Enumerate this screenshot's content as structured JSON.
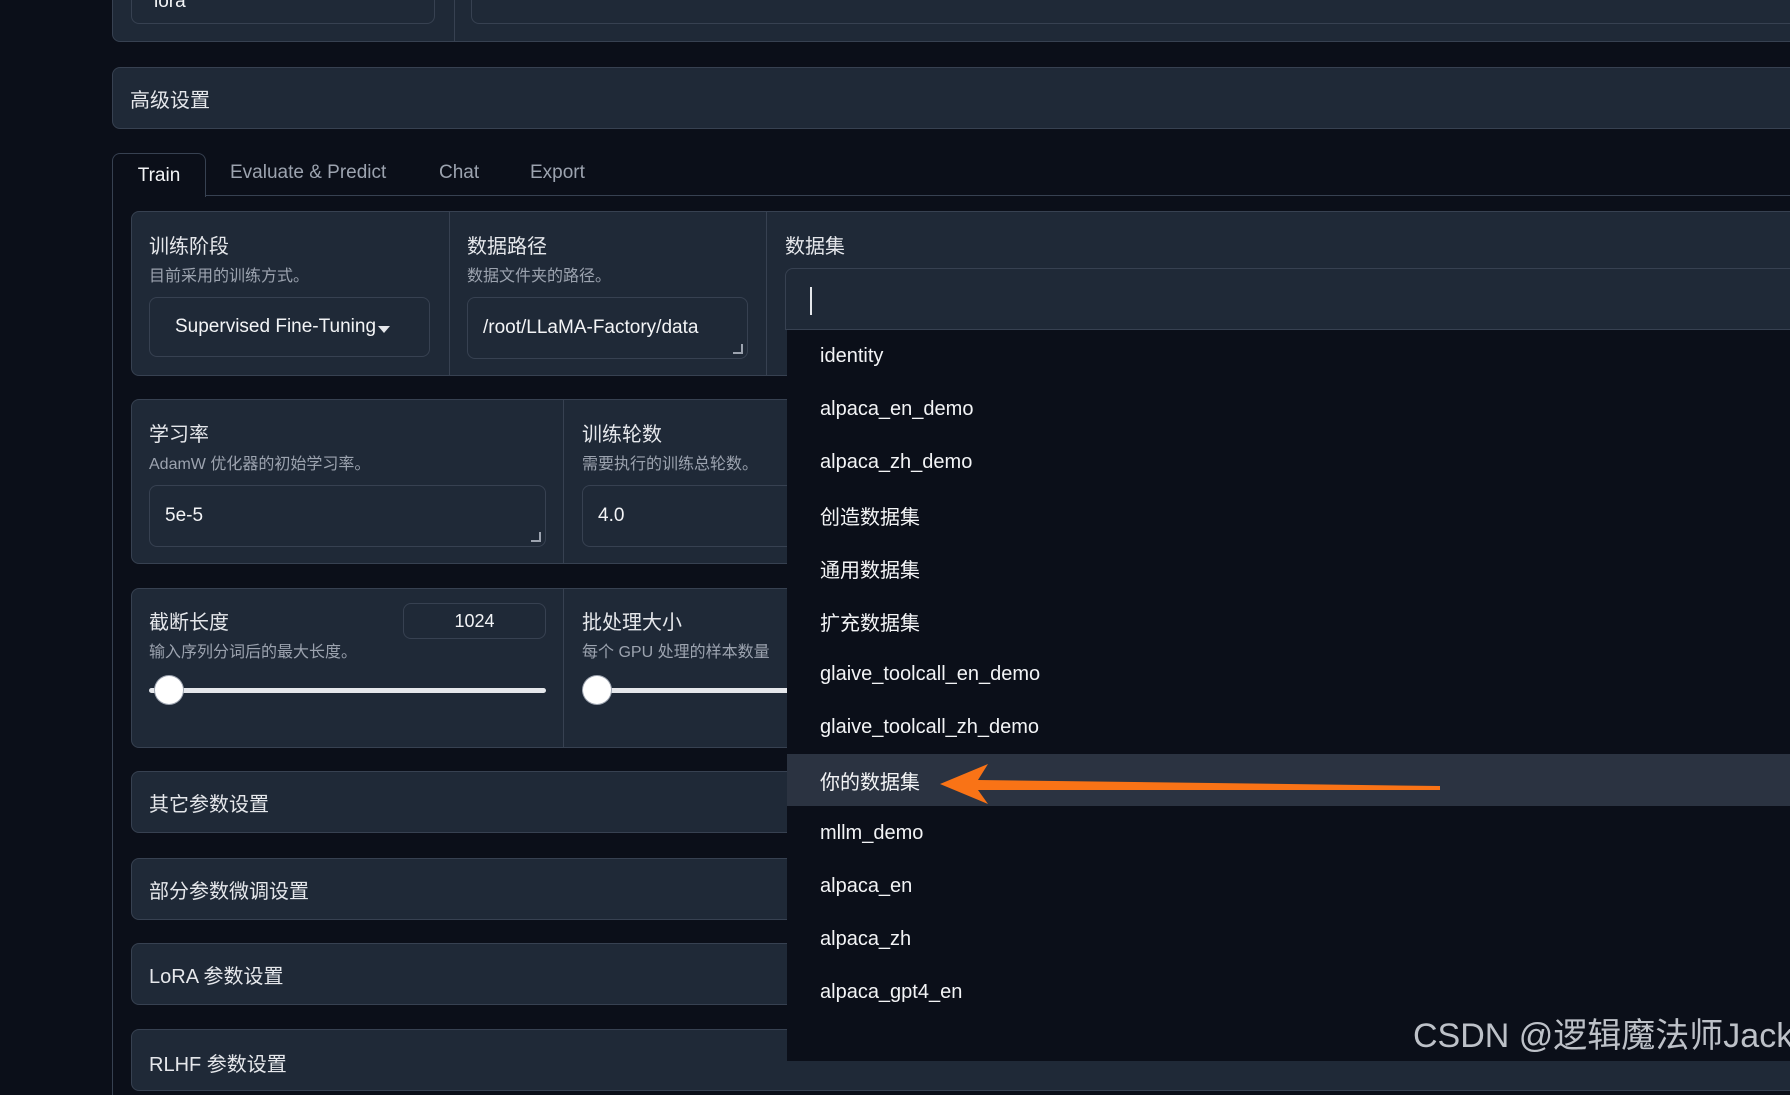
{
  "top_partial": {
    "left_value": "lora"
  },
  "advanced": {
    "label": "高级设置"
  },
  "tabs": [
    {
      "label": "Train",
      "active": true
    },
    {
      "label": "Evaluate & Predict",
      "active": false
    },
    {
      "label": "Chat",
      "active": false
    },
    {
      "label": "Export",
      "active": false
    }
  ],
  "stage": {
    "title": "训练阶段",
    "info": "目前采用的训练方式。",
    "value": "Supervised Fine-Tuning"
  },
  "data_path": {
    "title": "数据路径",
    "info": "数据文件夹的路径。",
    "value": "/root/LLaMA-Factory/data"
  },
  "dataset": {
    "title": "数据集",
    "options": [
      "identity",
      "alpaca_en_demo",
      "alpaca_zh_demo",
      "创造数据集",
      "通用数据集",
      "扩充数据集",
      "glaive_toolcall_en_demo",
      "glaive_toolcall_zh_demo",
      "你的数据集",
      "mllm_demo",
      "alpaca_en",
      "alpaca_zh",
      "alpaca_gpt4_en"
    ],
    "highlighted_index": 8
  },
  "learning_rate": {
    "title": "学习率",
    "info": "AdamW 优化器的初始学习率。",
    "value": "5e-5"
  },
  "epochs": {
    "title": "训练轮数",
    "info": "需要执行的训练总轮数。",
    "value": "4.0"
  },
  "cutoff": {
    "title": "截断长度",
    "info": "输入序列分词后的最大长度。",
    "value": "1024",
    "level": 0.05
  },
  "batch": {
    "title": "批处理大小",
    "info": "每个 GPU 处理的样本数量",
    "level": 0.03
  },
  "accordions": {
    "other": "其它参数设置",
    "partial": "部分参数微调设置",
    "lora": "LoRA 参数设置",
    "rlhf": "RLHF 参数设置"
  },
  "watermark": "CSDN @逻辑魔法师Jack",
  "colors": {
    "bg": "#0b0f19",
    "panel": "#1f2937",
    "border": "#374151",
    "arrow": "#f97316",
    "highlight": "#2b3341"
  }
}
